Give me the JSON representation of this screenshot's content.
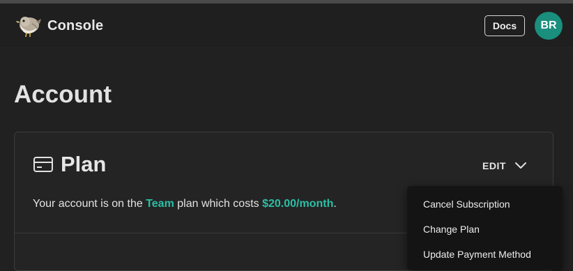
{
  "header": {
    "app_name": "Console",
    "logo_icon": "bird-icon",
    "docs_label": "Docs",
    "avatar_initials": "BR",
    "avatar_color": "#1a8f7e"
  },
  "page": {
    "title": "Account"
  },
  "plan_card": {
    "icon": "credit-card-icon",
    "title": "Plan",
    "edit_label": "EDIT",
    "edit_icon": "chevron-down-icon",
    "description_prefix": "Your account is on the ",
    "plan_name": "Team",
    "description_middle": " plan which costs ",
    "price": "$20.00/month",
    "description_suffix": ".",
    "accent_color": "#2bbfa5"
  },
  "edit_menu": {
    "items": [
      {
        "label": "Cancel Subscription"
      },
      {
        "label": "Change Plan"
      },
      {
        "label": "Update Payment Method"
      }
    ]
  }
}
